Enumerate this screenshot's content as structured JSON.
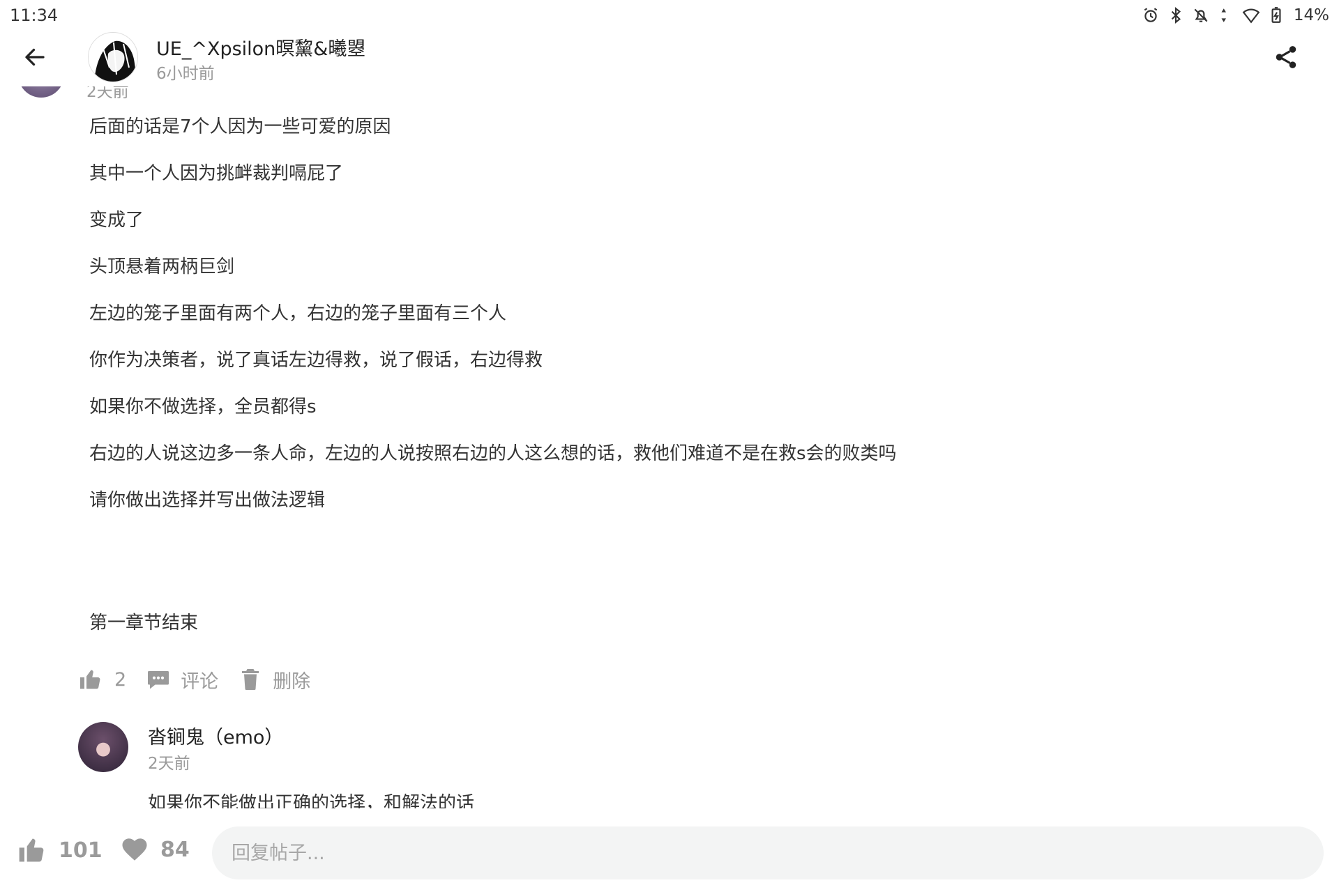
{
  "status_bar": {
    "time": "11:34",
    "battery": "14%",
    "icons": [
      "alarm-icon",
      "bluetooth-icon",
      "notifications-off-icon",
      "data-transfer-icon",
      "wifi-icon",
      "battery-charging-icon"
    ]
  },
  "header": {
    "back_icon": "arrow-left-icon",
    "author": "UE_^Xpsilon暝黧&曦曌",
    "time": "6小时前",
    "share_icon": "share-icon"
  },
  "previous_comment": {
    "time": "2天前"
  },
  "post": {
    "lines": [
      "后面的话是7个人因为一些可爱的原因",
      "其中一个人因为挑衅裁判嗝屁了",
      "变成了",
      "头顶悬着两柄巨剑",
      "左边的笼子里面有两个人，右边的笼子里面有三个人",
      "你作为决策者，说了真话左边得救，说了假话，右边得救",
      "如果你不做选择，全员都得s",
      "右边的人说这边多一条人命，左边的人说按照右边的人这么想的话，救他们难道不是在救s会的败类吗",
      "请你做出选择并写出做法逻辑"
    ],
    "ending": "第一章节结束"
  },
  "actions": {
    "like_count": "2",
    "comment_label": "评论",
    "delete_label": "删除"
  },
  "comment": {
    "author": "沓锏鬼（emo）",
    "time": "2天前",
    "text": "如果你不能做出正确的选择，和解法的话"
  },
  "bottom_bar": {
    "like_count": "101",
    "favorite_count": "84",
    "reply_placeholder": "回复帖子..."
  },
  "colors": {
    "muted": "#9a9a9a",
    "text": "#333333",
    "input_bg": "#f3f4f4"
  }
}
